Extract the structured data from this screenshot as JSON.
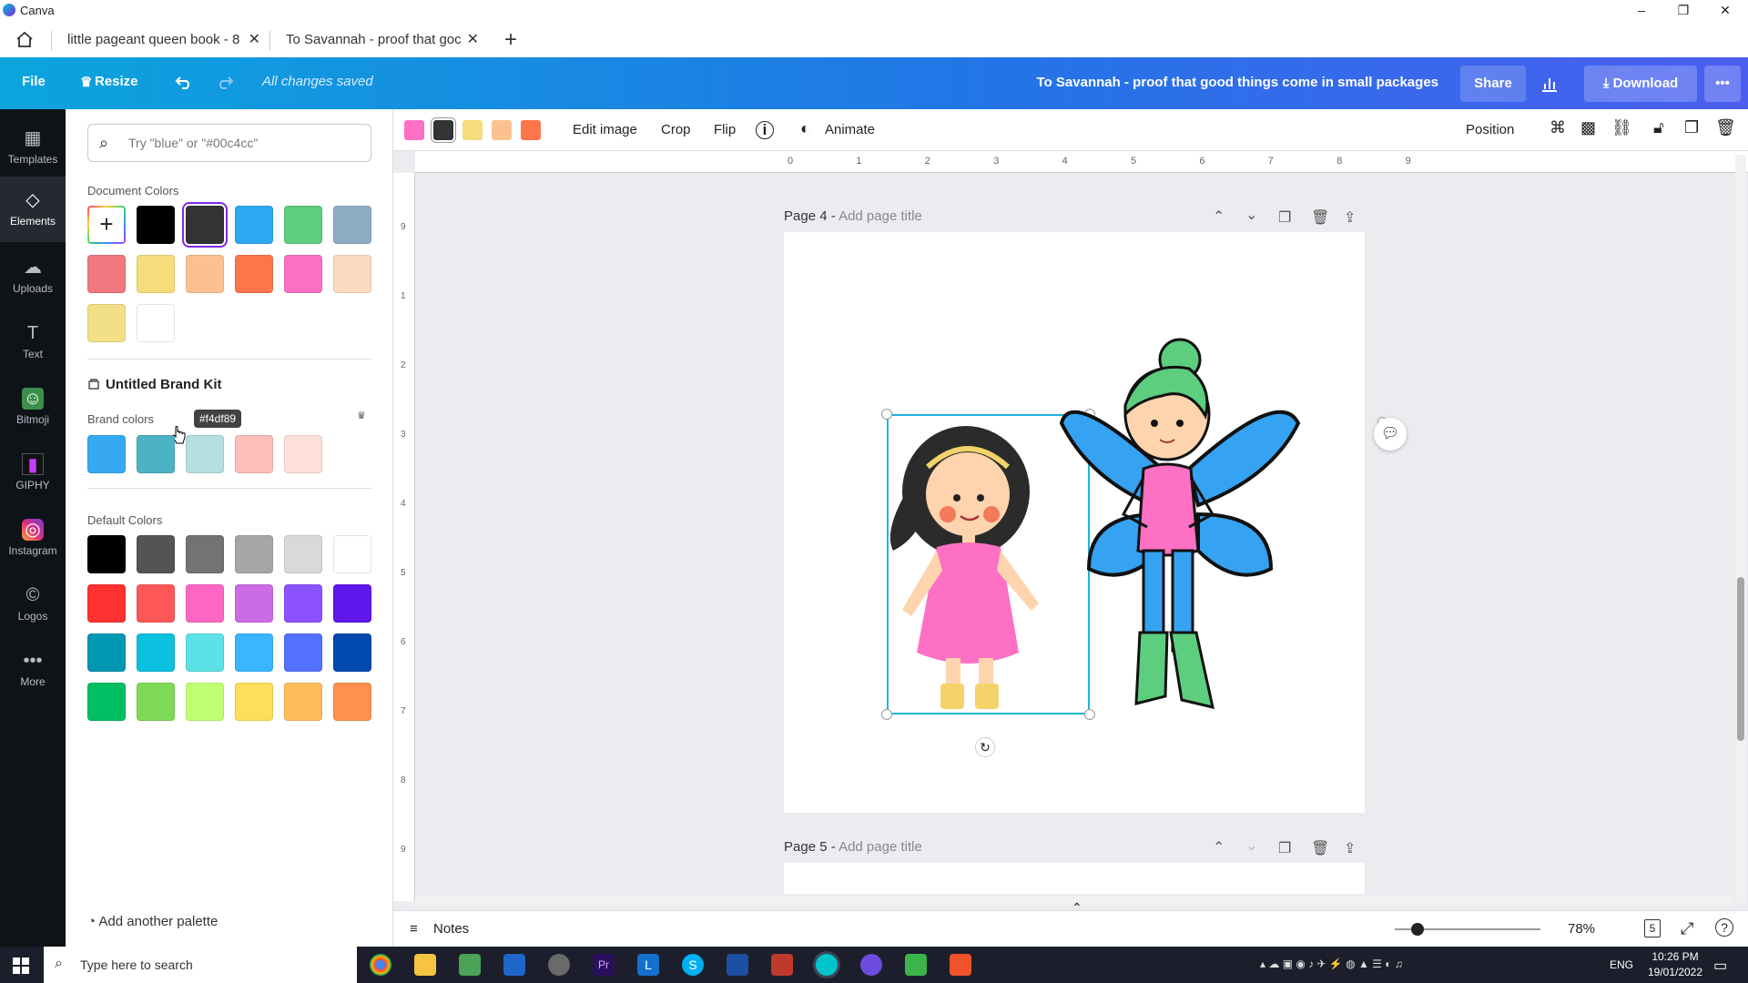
{
  "window": {
    "app_name": "Canva",
    "minimize": "–",
    "restore": "❐",
    "close": "✕"
  },
  "tabs": [
    {
      "label": "little pageant queen book - 8",
      "close": "✕"
    },
    {
      "label": "To Savannah - proof that goc",
      "close": "✕"
    }
  ],
  "new_tab": "+",
  "toolbar": {
    "file": "File",
    "resize": "Resize",
    "saved_status": "All changes saved",
    "doc_title": "To Savannah - proof that good things come in small packages",
    "share": "Share",
    "download": "Download",
    "more": "•••",
    "undo_icon": "undo-icon",
    "redo_icon": "redo-icon"
  },
  "rail": [
    {
      "label": "Templates",
      "icon": "▦"
    },
    {
      "label": "Elements",
      "icon": "◇"
    },
    {
      "label": "Uploads",
      "icon": "☁"
    },
    {
      "label": "Text",
      "icon": "T"
    },
    {
      "label": "Bitmoji",
      "icon": "☺"
    },
    {
      "label": "GIPHY",
      "icon": "▮"
    },
    {
      "label": "Instagram",
      "icon": "◎"
    },
    {
      "label": "Logos",
      "icon": "©"
    },
    {
      "label": "More",
      "icon": "•••"
    }
  ],
  "panel": {
    "search_placeholder": "Try \"blue\" or \"#00c4cc\"",
    "document_colors_title": "Document Colors",
    "document_colors": [
      "#000000",
      "#333333",
      "#2ca8f2",
      "#5cce7e",
      "#8eaec6",
      "#f0787e",
      "#f7dc7b",
      "#fbc28f",
      "#fd754b",
      "#fd70c4",
      "#fddbc0",
      "#f4df89",
      "#ffffff"
    ],
    "brand_kit_title": "Untitled Brand Kit",
    "brand_colors_title": "Brand colors",
    "brand_colors": [
      "#35aaf2",
      "#4cb3c4",
      "#b4dfe0",
      "#fdbdbb",
      "#fde1d9"
    ],
    "default_colors_title": "Default Colors",
    "default_colors": [
      "#000000",
      "#545454",
      "#737373",
      "#a6a6a6",
      "#d9d9d9",
      "#ffffff",
      "#ff3131",
      "#ff5757",
      "#ff66c4",
      "#cb6ce6",
      "#8c52ff",
      "#5e17eb",
      "#0097b2",
      "#0cc0df",
      "#5ce1e6",
      "#38b6ff",
      "#5271ff",
      "#004aad",
      "#00bf63",
      "#7ed957",
      "#c1ff72",
      "#ffde59",
      "#ffbd59",
      "#ff914d"
    ],
    "tooltip": "#f4df89",
    "add_palette": "Add another palette"
  },
  "context_bar": {
    "swatches": [
      "#fd70c4",
      "#333333",
      "#f7dc7b",
      "#fbc28f",
      "#fd754b"
    ],
    "edit_image": "Edit image",
    "crop": "Crop",
    "flip": "Flip",
    "animate": "Animate",
    "position": "Position"
  },
  "ruler_ticks": [
    "0",
    "1",
    "2",
    "3",
    "4",
    "5",
    "6",
    "7",
    "8",
    "9"
  ],
  "vruler_ticks": [
    "9",
    "1",
    "2",
    "3",
    "4",
    "5",
    "6",
    "7",
    "8",
    "9"
  ],
  "pages": [
    {
      "label": "Page 4 -",
      "title_placeholder": "Add page title"
    },
    {
      "label": "Page 5 -",
      "title_placeholder": "Add page title"
    }
  ],
  "bottom": {
    "notes": "Notes",
    "zoom": "78%",
    "page_count": "5"
  },
  "taskbar": {
    "search_placeholder": "Type here to search",
    "time": "10:26 PM",
    "date": "19/01/2022",
    "lang": "ENG"
  }
}
